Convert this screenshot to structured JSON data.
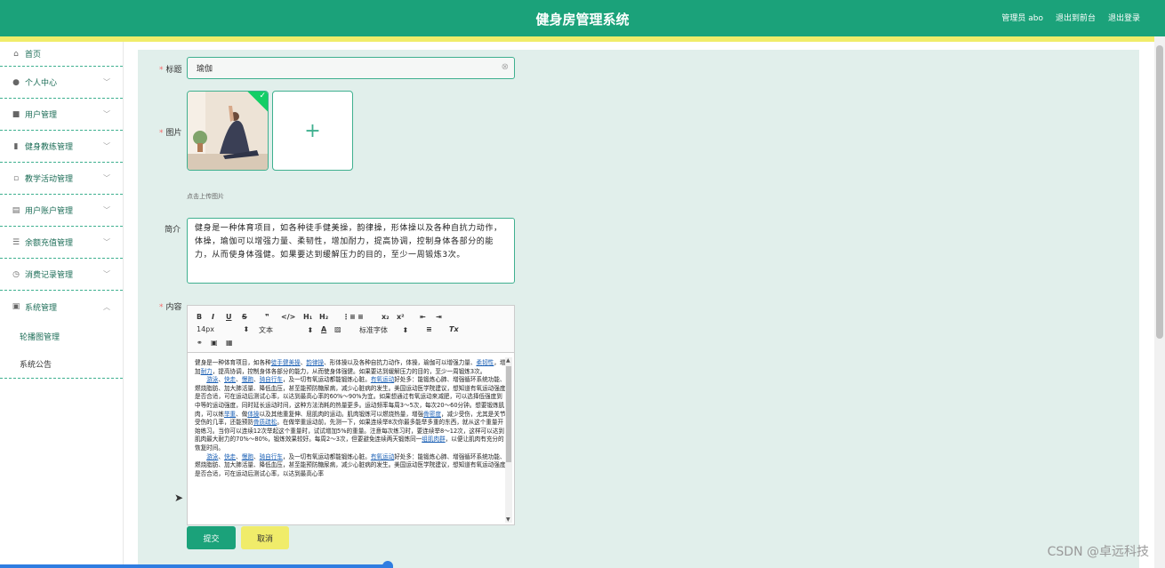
{
  "header": {
    "title": "健身房管理系统",
    "admin_label": "管理员 abo",
    "back_label": "退出到前台",
    "logout_label": "退出登录"
  },
  "sidebar": {
    "items": [
      {
        "label": "首页",
        "icon": "home-icon",
        "glyph": "⌂"
      },
      {
        "label": "个人中心",
        "icon": "user-icon",
        "glyph": "●"
      },
      {
        "label": "用户管理",
        "icon": "users-icon",
        "glyph": "■"
      },
      {
        "label": "健身教练管理",
        "icon": "chart-icon",
        "glyph": "▮"
      },
      {
        "label": "教学活动管理",
        "icon": "crop-icon",
        "glyph": "▫"
      },
      {
        "label": "用户账户管理",
        "icon": "doc-icon",
        "glyph": "▤"
      },
      {
        "label": "余额充值管理",
        "icon": "list-icon",
        "glyph": "☰"
      },
      {
        "label": "消费记录管理",
        "icon": "clock-icon",
        "glyph": "◷"
      },
      {
        "label": "系统管理",
        "icon": "clipboard-icon",
        "glyph": "▣"
      }
    ],
    "sub_items": [
      {
        "label": "轮播图管理"
      },
      {
        "label": "系统公告"
      }
    ]
  },
  "form": {
    "title_label": "标题",
    "title_value": "瑜伽",
    "image_label": "图片",
    "upload_hint": "点击上传图片",
    "summary_label": "简介",
    "summary_value": "健身是一种体育项目，如各种徒手健美操，韵律操，形体操以及各种自抗力动作，体操，瑜伽可以增强力量、柔韧性，增加耐力，提高协调，控制身体各部分的能力，从而使身体强健。如果要达到缓解压力的目的，至少一周锻炼3次。",
    "content_label": "内容",
    "submit_label": "提交",
    "cancel_label": "取消"
  },
  "editor": {
    "font_size": "14px",
    "text_style": "文本",
    "font_family": "标准字体",
    "paragraphs": [
      [
        "健身是一种体育项目，如各种",
        {
          "link": "徒手健美操"
        },
        "、",
        {
          "link": "韵律操"
        },
        "、形体操以及各种自抗力动作，体操，瑜伽可以增强力量、",
        {
          "link": "柔韧性"
        },
        "，增加",
        {
          "link": "耐力"
        },
        "，提高协调，控制身体各部分的能力，从而使身体强健。如果要达到缓解压力的目的，至少一周锻炼3次。"
      ],
      [
        "　　",
        {
          "link": "游泳"
        },
        "、",
        {
          "link": "快走"
        },
        "、",
        {
          "link": "慢跑"
        },
        "、",
        {
          "link": "骑自行车"
        },
        "，及一切有氧运动都能锻炼心脏。",
        {
          "link": "有氧运动"
        },
        "好处多：能锻炼心肺、增强循环系统功能、燃烧脂肪、加大肺活量、降低血压，甚至能预防糖尿病，减少心脏病的发生。美国运动医学院建议，想知道有氧运动强度是否合适，可在运动后测试心率，以达到最高心率的60%～90%为宜。如果想通过有氧运动来减肥，可以选择低强度到中等的运动强度，同时延长运动时间，这种方法消耗的热量更多。运动频率每周3～5次，每次20～60分钟。想要锻炼肌肉，可以练",
        {
          "link": "举重"
        },
        "、做",
        {
          "link": "体操"
        },
        "以及其他重复伸、屈肌肉的运动。肌肉锻炼可以燃烧热量，增强",
        {
          "link": "骨密度"
        },
        "，减少受伤，尤其是关节受伤的几率，还能预防",
        {
          "link": "骨质疏松"
        },
        "。在做举重运动前，先测一下，如果连续举8次你最多能举多重的东西，就从这个重量开始练习。当你可以连续12次举起这个重量时，试试增加5%的重量。注意每次练习时，要连续举8～12次，这样可以达到肌肉最大耐力的70%～80%，锻炼效果较好。每周2～3次，但要避免连续两天锻炼同一",
        {
          "link": "组肌肉群"
        },
        "，以便让肌肉有充分的恢复时间。"
      ],
      [
        "　　",
        {
          "link": "游泳"
        },
        "、",
        {
          "link": "快走"
        },
        "、",
        {
          "link": "慢跑"
        },
        "、",
        {
          "link": "骑自行车"
        },
        "，及一切有氧运动都能锻炼心脏。",
        {
          "link": "有氧运动"
        },
        "好处多：能锻炼心肺、增强循环系统功能、燃烧脂肪、加大肺活量、降低血压，甚至能预防糖尿病，减少心脏病的发生。美国运动医学院建议，想知道有氧运动强度是否合适，可在运动后测试心率，以达到最高心率"
      ]
    ]
  },
  "watermark": "CSDN @卓远科技",
  "colors": {
    "primary": "#1ba27a",
    "accent_yellow": "#f0ec6a",
    "panel_bg": "#e1efeb"
  }
}
